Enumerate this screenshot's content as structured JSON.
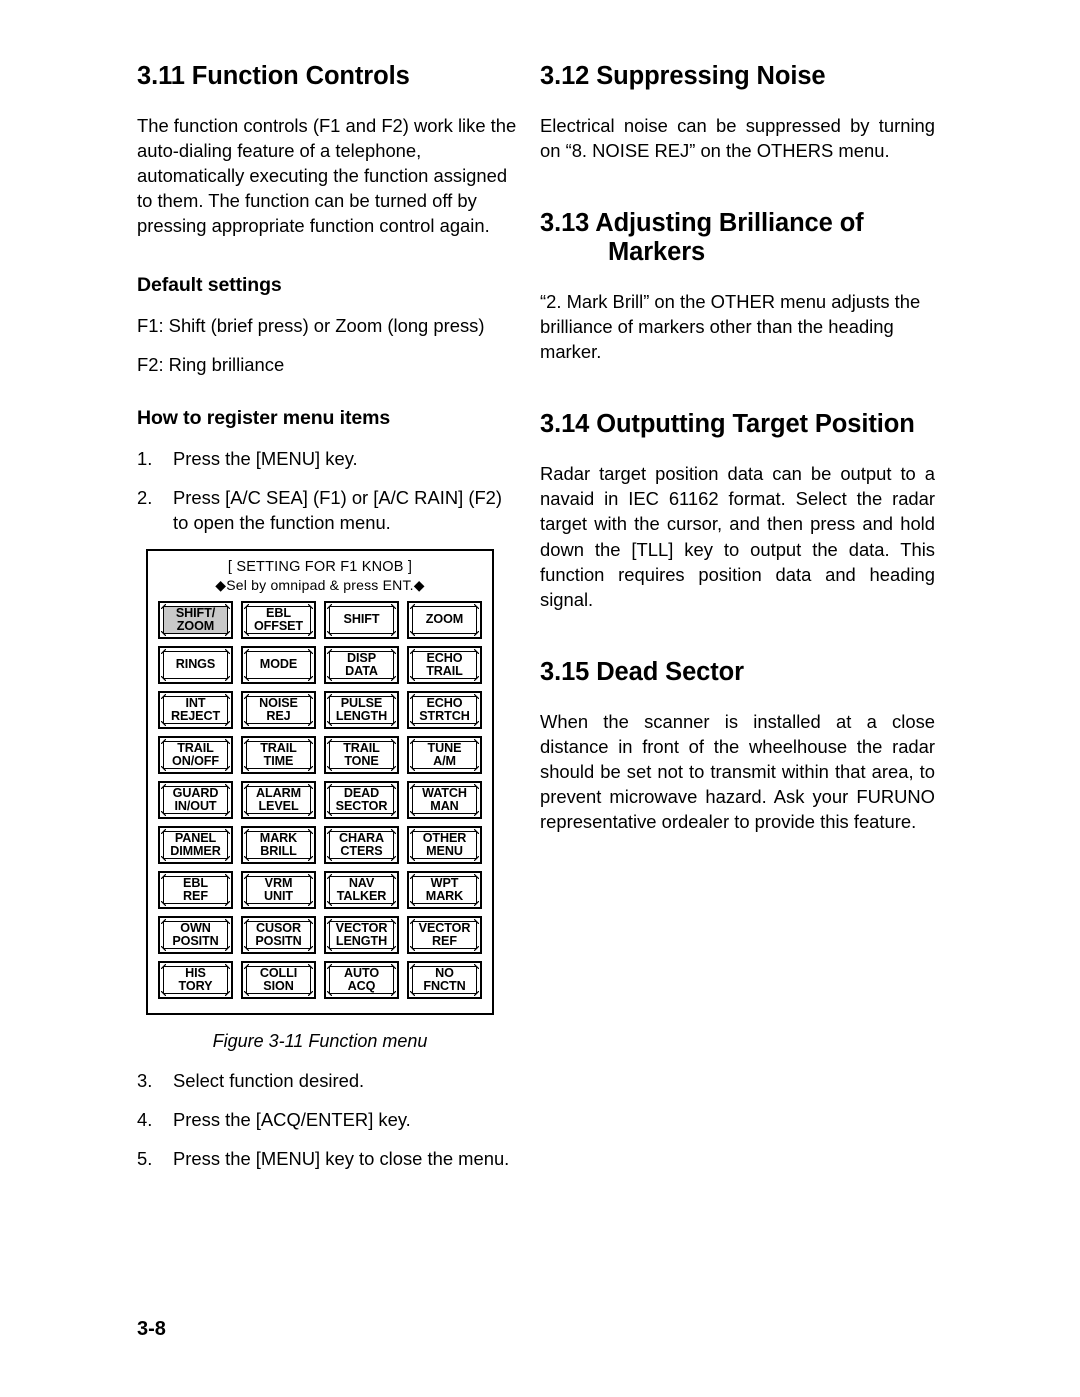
{
  "page": {
    "number": "3-8"
  },
  "left_column": {
    "section_311": {
      "heading": "3.11 Function Controls",
      "paragraph": "The function controls (F1 and F2) work like the auto-dialing feature of a telephone, automatically executing the function assigned to them. The function can be turned off by pressing appropriate function control again."
    },
    "default_settings": {
      "heading": "Default settings",
      "f1": "F1: Shift (brief press) or Zoom (long press)",
      "f2": "F2: Ring brilliance"
    },
    "register_menu_items": {
      "heading": "How to register menu items",
      "steps_before_figure": [
        {
          "num": "1.",
          "text": "Press the [MENU] key."
        },
        {
          "num": "2.",
          "text": "Press [A/C SEA] (F1) or [A/C RAIN] (F2) to open the function menu."
        }
      ],
      "steps_after_figure": [
        {
          "num": "3.",
          "text": "Select function desired."
        },
        {
          "num": "4.",
          "text": "Press the [ACQ/ENTER] key."
        },
        {
          "num": "5.",
          "text": "Press the [MENU] key to close the menu."
        }
      ]
    },
    "figure": {
      "caption": "Figure 3-11 Function menu",
      "menu_title_line1": "[ SETTING FOR F1 KNOB ]",
      "menu_title_line2": "◆Sel by omnipad & press ENT.◆",
      "selected_color": "#c9c9c9",
      "rows": [
        [
          {
            "line1": "SHIFT/",
            "line2": "ZOOM",
            "selected": true
          },
          {
            "line1": "EBL",
            "line2": "OFFSET",
            "selected": false
          },
          {
            "line1": "SHIFT",
            "line2": "",
            "selected": false
          },
          {
            "line1": "ZOOM",
            "line2": "",
            "selected": false
          }
        ],
        [
          {
            "line1": "RINGS",
            "line2": "",
            "selected": false
          },
          {
            "line1": "MODE",
            "line2": "",
            "selected": false
          },
          {
            "line1": "DISP",
            "line2": "DATA",
            "selected": false
          },
          {
            "line1": "ECHO",
            "line2": "TRAIL",
            "selected": false
          }
        ],
        [
          {
            "line1": "INT",
            "line2": "REJECT",
            "selected": false
          },
          {
            "line1": "NOISE",
            "line2": "REJ",
            "selected": false
          },
          {
            "line1": "PULSE",
            "line2": "LENGTH",
            "selected": false
          },
          {
            "line1": "ECHO",
            "line2": "STRTCH",
            "selected": false
          }
        ],
        [
          {
            "line1": "TRAIL",
            "line2": "ON/OFF",
            "selected": false
          },
          {
            "line1": "TRAIL",
            "line2": "TIME",
            "selected": false
          },
          {
            "line1": "TRAIL",
            "line2": "TONE",
            "selected": false
          },
          {
            "line1": "TUNE",
            "line2": "A/M",
            "selected": false
          }
        ],
        [
          {
            "line1": "GUARD",
            "line2": "IN/OUT",
            "selected": false
          },
          {
            "line1": "ALARM",
            "line2": "LEVEL",
            "selected": false
          },
          {
            "line1": "DEAD",
            "line2": "SECTOR",
            "selected": false
          },
          {
            "line1": "WATCH",
            "line2": "MAN",
            "selected": false
          }
        ],
        [
          {
            "line1": "PANEL",
            "line2": "DIMMER",
            "selected": false
          },
          {
            "line1": "MARK",
            "line2": "BRILL",
            "selected": false
          },
          {
            "line1": "CHARA",
            "line2": "CTERS",
            "selected": false
          },
          {
            "line1": "OTHER",
            "line2": "MENU",
            "selected": false
          }
        ],
        [
          {
            "line1": "EBL",
            "line2": "REF",
            "selected": false
          },
          {
            "line1": "VRM",
            "line2": "UNIT",
            "selected": false
          },
          {
            "line1": "NAV",
            "line2": "TALKER",
            "selected": false
          },
          {
            "line1": "WPT",
            "line2": "MARK",
            "selected": false
          }
        ],
        [
          {
            "line1": "OWN",
            "line2": "POSITN",
            "selected": false
          },
          {
            "line1": "CUSOR",
            "line2": "POSITN",
            "selected": false
          },
          {
            "line1": "VECTOR",
            "line2": "LENGTH",
            "selected": false
          },
          {
            "line1": "VECTOR",
            "line2": "REF",
            "selected": false
          }
        ],
        [
          {
            "line1": "HIS",
            "line2": "TORY",
            "selected": false
          },
          {
            "line1": "COLLI",
            "line2": "SION",
            "selected": false
          },
          {
            "line1": "AUTO",
            "line2": "ACQ",
            "selected": false
          },
          {
            "line1": "NO",
            "line2": "FNCTN",
            "selected": false
          }
        ]
      ]
    }
  },
  "right_column": {
    "section_312": {
      "heading": "3.12 Suppressing Noise",
      "paragraph": "Electrical noise can be suppressed by turning on “8. NOISE REJ” on the OTHERS menu."
    },
    "section_313": {
      "heading": "3.13 Adjusting Brilliance of Markers",
      "paragraph": "“2. Mark Brill” on the OTHER menu adjusts the brilliance of markers other than the heading marker."
    },
    "section_314": {
      "heading": "3.14 Outputting Target Position",
      "paragraph": "Radar target position data can be output to a navaid in IEC 61162 format. Select the radar target with the cursor, and then press and hold down the [TLL] key to output the data. This function requires position data and heading signal."
    },
    "section_315": {
      "heading": "3.15 Dead Sector",
      "paragraph": "When the scanner is installed at a close distance in front of the wheelhouse the radar should be set not to transmit within that area, to prevent microwave hazard. Ask your FURUNO representative ordealer to provide this feature."
    }
  }
}
